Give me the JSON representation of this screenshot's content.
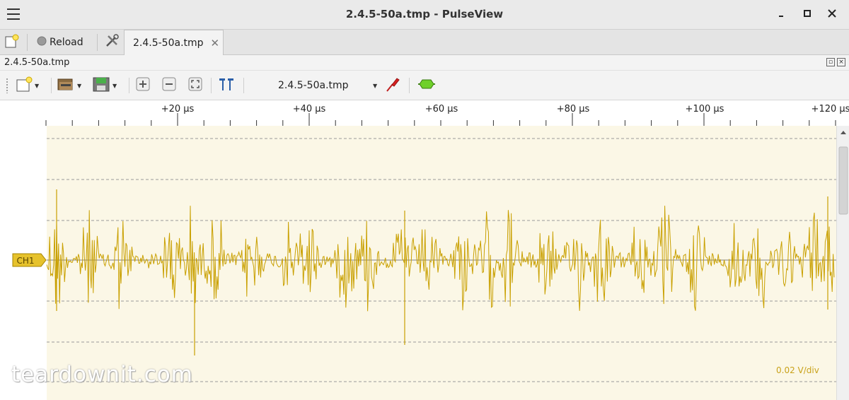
{
  "window": {
    "title": "2.4.5-50a.tmp - PulseView"
  },
  "tabbar": {
    "reload_label": "Reload",
    "tab_label": "2.4.5-50a.tmp"
  },
  "dock": {
    "title": "2.4.5-50a.tmp"
  },
  "toolbar": {
    "device_label": "2.4.5-50a.tmp"
  },
  "ruler": {
    "labels": [
      "+20 µs",
      "+40 µs",
      "+60 µs",
      "+80 µs",
      "+100 µs",
      "+120 µs"
    ]
  },
  "trace": {
    "channel_label": "CH1",
    "vdiv_label": "0.02 V/div",
    "watermark": "teardownit.com"
  },
  "colors": {
    "signal": "#c9a000",
    "trace_bg": "#fbf7e6",
    "channel_tag": "#e6c22c"
  }
}
